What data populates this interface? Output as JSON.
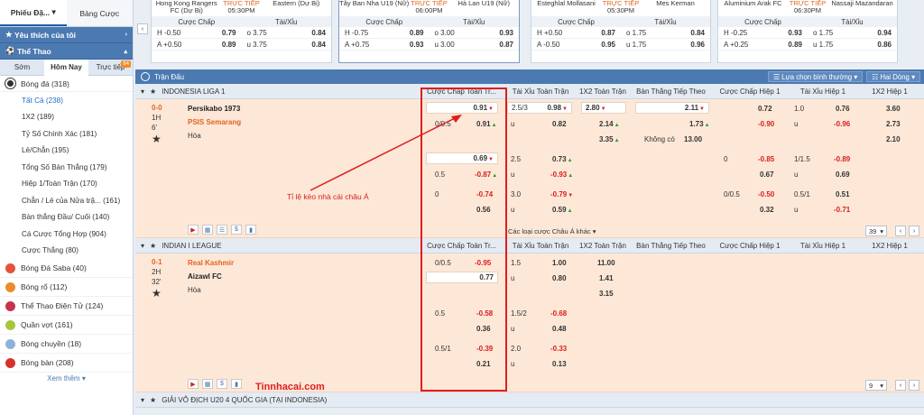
{
  "sidebar": {
    "tabs": [
      "Phiếu Đặ...",
      "Bảng Cược"
    ],
    "favorites": "Yêu thích của tôi",
    "sports_header": "Thể Thao",
    "subtabs": [
      "Sớm",
      "Hôm Nay",
      "Trực tiếp"
    ],
    "live_badge": "84",
    "football": "Bóng đá (318)",
    "football_items": [
      "Tất Cả (238)",
      "1X2 (189)",
      "Tỷ Số Chính Xác (181)",
      "Lẻ/Chẵn (195)",
      "Tổng Số Bàn Thắng (179)",
      "Hiệp 1/Toàn Trận (170)",
      "Chẵn / Lẻ của Nửa trậ... (161)",
      "Bàn thắng Đầu/ Cuối (140)",
      "Cá Cược Tổng Hợp (904)",
      "Cược Thắng (80)"
    ],
    "other_sports": [
      "Bóng Đá Saba (40)",
      "Bóng rổ (112)",
      "Thể Thao Điện Tử (124)",
      "Quần vợt (161)",
      "Bóng chuyền (18)",
      "Bóng bàn (208)"
    ],
    "see_more": "Xem thêm"
  },
  "top_cards": [
    {
      "home": "Hong Kong Rangers FC (Dự Bị)",
      "status": "TRỰC TIẾP",
      "time": "05:30PM",
      "away": "Eastern (Dự Bị)",
      "h_label": "H",
      "h_hdp": "-0.50",
      "h_price": "0.79",
      "h_ou": "o 3.75",
      "h_ou_price": "0.84",
      "a_label": "A",
      "a_hdp": "+0.50",
      "a_price": "0.89",
      "a_ou": "u 3.75",
      "a_ou_price": "0.84"
    },
    {
      "home": "Tây Ban Nha U19 (Nữ)",
      "status": "TRỰC TIẾP",
      "time": "06:00PM",
      "away": "Hà Lan U19 (Nữ)",
      "h_label": "H",
      "h_hdp": "-0.75",
      "h_price": "0.89",
      "h_ou": "o 3.00",
      "h_ou_price": "0.93",
      "a_label": "A",
      "a_hdp": "+0.75",
      "a_price": "0.93",
      "a_ou": "u 3.00",
      "a_ou_price": "0.87"
    },
    {
      "home": "Esteghlal Mollasani",
      "status": "TRỰC TIẾP",
      "time": "05:30PM",
      "away": "Mes Kerman",
      "h_label": "H",
      "h_hdp": "+0.50",
      "h_price": "0.87",
      "h_ou": "o 1.75",
      "h_ou_price": "0.84",
      "a_label": "A",
      "a_hdp": "-0.50",
      "a_price": "0.95",
      "a_ou": "u 1.75",
      "a_ou_price": "0.96"
    },
    {
      "home": "Aluminium Arak FC",
      "status": "TRỰC TIẾP",
      "time": "06:30PM",
      "away": "Nassaji Mazandaran",
      "h_label": "H",
      "h_hdp": "-0.25",
      "h_price": "0.93",
      "h_ou": "o 1.75",
      "h_ou_price": "0.94",
      "a_label": "A",
      "a_hdp": "+0.25",
      "a_price": "0.89",
      "a_ou": "u 1.75",
      "a_ou_price": "0.86"
    }
  ],
  "top_headers": {
    "hdp": "Cược Chấp",
    "ou": "Tài/Xỉu"
  },
  "main": {
    "title": "Trận Đấu",
    "sort_btn": "Lựa chọn bình thường",
    "view_btn": "Hai Dòng",
    "columns": [
      "Cược Chấp Toàn Tr...",
      "Tài Xỉu Toàn Trận",
      "1X2 Toàn Trận",
      "Bàn Thắng Tiếp Theo",
      "Cược Chấp Hiệp 1",
      "Tài Xỉu Hiệp 1",
      "1X2 Hiệp 1"
    ]
  },
  "league1": {
    "name": "INDONESIA LIGA 1",
    "score": "0-0",
    "period": "1H",
    "minute": "6'",
    "home": "Persikabo 1973",
    "away": "PSIS Semarang",
    "draw": "Hòa",
    "r1": {
      "hdp_line": "",
      "hdp_home": "0.91",
      "ou_line": "2.5/3",
      "ou_o": "0.98",
      "x1": "2.80",
      "ng_h": "2.11",
      "fh_h": "0.72",
      "fh_ou_line": "1.0",
      "fh_ou_o": "0.76",
      "fx1": "3.60"
    },
    "r2": {
      "hdp_line": "0/0.5",
      "hdp_away": "0.91",
      "ou_u": "u",
      "ou_u_price": "0.82",
      "x2": "2.14",
      "ng_a": "1.73",
      "fh_a": "-0.90",
      "fh_ou_u": "u",
      "fh_ou_u_price": "-0.96",
      "fx2": "2.73"
    },
    "r3": {
      "x3": "3.35",
      "ng_none_label": "Không có",
      "ng_none": "13.00",
      "fx3": "2.10"
    },
    "alt1": {
      "hdp_home": "0.69",
      "hdp_line": "0.5",
      "hdp_away": "-0.87",
      "ou_line": "2.5",
      "ou_o": "0.73",
      "ou_u": "u",
      "ou_u_price": "-0.93",
      "fh_line": "0",
      "fh_h": "-0.85",
      "fh_a": "0.67",
      "fh_ou_line": "1/1.5",
      "fh_ou_o": "-0.89",
      "fh_ou_u": "u",
      "fh_ou_u_price": "0.69"
    },
    "alt2": {
      "hdp_line": "0",
      "hdp_home": "-0.74",
      "hdp_away": "0.56",
      "ou_line": "3.0",
      "ou_o": "-0.79",
      "ou_u": "u",
      "ou_u_price": "0.59",
      "fh_line": "0/0.5",
      "fh_h": "-0.50",
      "fh_a": "0.32",
      "fh_ou_line": "0.5/1",
      "fh_ou_o": "0.51",
      "fh_ou_u": "u",
      "fh_ou_u_price": "-0.71"
    },
    "more_bets": "Các loại cược Châu Á khác",
    "pager": "39"
  },
  "league2": {
    "name": "INDIAN I LEAGUE",
    "score": "0-1",
    "period": "2H",
    "minute": "32'",
    "home": "Real Kashmir",
    "away": "Aizawl FC",
    "draw": "Hòa",
    "r1": {
      "hdp_line": "0/0.5",
      "hdp_home": "-0.95",
      "ou_line": "1.5",
      "ou_o": "1.00",
      "x1": "11.00"
    },
    "r2": {
      "hdp_away": "0.77",
      "ou_u": "u",
      "ou_u_price": "0.80",
      "x2": "1.41"
    },
    "r3": {
      "x3": "3.15"
    },
    "alt1": {
      "hdp_line": "0.5",
      "hdp_home": "-0.58",
      "hdp_away": "0.36",
      "ou_line": "1.5/2",
      "ou_o": "-0.68",
      "ou_u": "u",
      "ou_u_price": "0.48"
    },
    "alt2": {
      "hdp_line": "0.5/1",
      "hdp_home": "-0.39",
      "hdp_away": "0.21",
      "ou_line": "2.0",
      "ou_o": "-0.33",
      "ou_u": "u",
      "ou_u_price": "0.13"
    },
    "pager": "9"
  },
  "league3": {
    "name": "GIẢI VÔ ĐỊCH U20 4 QUỐC GIA (TẠI INDONESIA)"
  },
  "annotation": "Tỉ lệ  kèo nhà cái châu Á",
  "watermark": "Tinnhacai.com",
  "colors": {
    "accent": "#4b79b2",
    "highlight": "#e01d1d",
    "live": "#e0641e",
    "row_bg": "#fde8d8"
  }
}
